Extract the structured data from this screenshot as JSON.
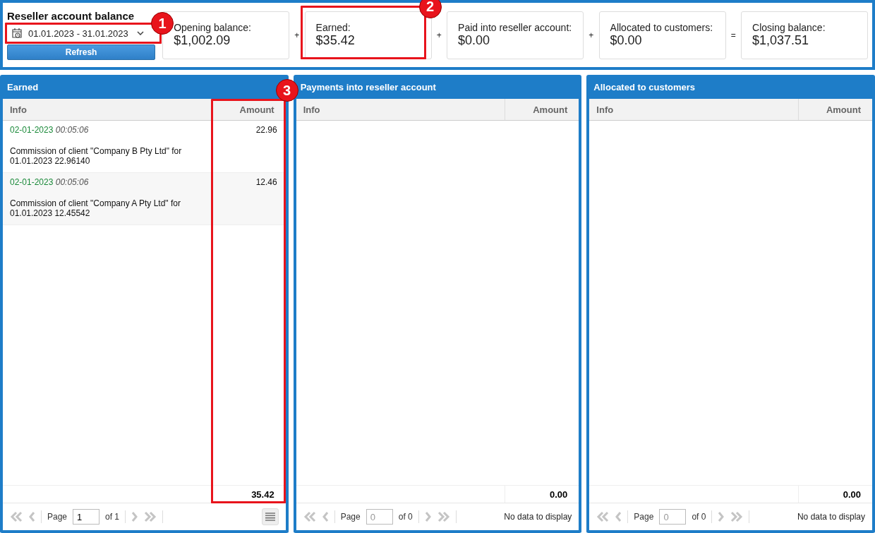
{
  "header": {
    "title": "Reseller account balance",
    "date_range": "01.01.2023 - 31.01.2023",
    "refresh_label": "Refresh",
    "cards": [
      {
        "label": "Opening balance:",
        "value": "$1,002.09"
      },
      {
        "operator": "+",
        "label": "Earned:",
        "value": "$35.42"
      },
      {
        "operator": "+",
        "label": "Paid into reseller account:",
        "value": "$0.00"
      },
      {
        "operator": "+",
        "label": "Allocated to customers:",
        "value": "$0.00"
      },
      {
        "operator": "=",
        "label": "Closing balance:",
        "value": "$1,037.51"
      }
    ]
  },
  "panels": [
    {
      "title": "Earned",
      "columns": [
        "Info",
        "Amount"
      ],
      "rows": [
        {
          "date": "02-01-2023",
          "time": "00:05:06",
          "description": "Commission of client \"Company B Pty Ltd\" for 01.01.2023 22.96140",
          "amount": "22.96"
        },
        {
          "date": "02-01-2023",
          "time": "00:05:06",
          "description": "Commission of client \"Company A Pty Ltd\" for 01.01.2023 12.45542",
          "amount": "12.46"
        }
      ],
      "total": "35.42",
      "pager": {
        "page_label": "Page",
        "page": "1",
        "of": "of 1",
        "disabled": false
      }
    },
    {
      "title": "Payments into reseller account",
      "columns": [
        "Info",
        "Amount"
      ],
      "total": "0.00",
      "pager": {
        "page_label": "Page",
        "page": "0",
        "of": "of 0",
        "disabled": true,
        "status": "No data to display"
      }
    },
    {
      "title": "Allocated to customers",
      "columns": [
        "Info",
        "Amount"
      ],
      "total": "0.00",
      "pager": {
        "page_label": "Page",
        "page": "0",
        "of": "of 0",
        "disabled": true,
        "status": "No data to display"
      }
    }
  ],
  "callouts": {
    "date_range": "1",
    "earned_card": "2",
    "amount_column": "3"
  }
}
